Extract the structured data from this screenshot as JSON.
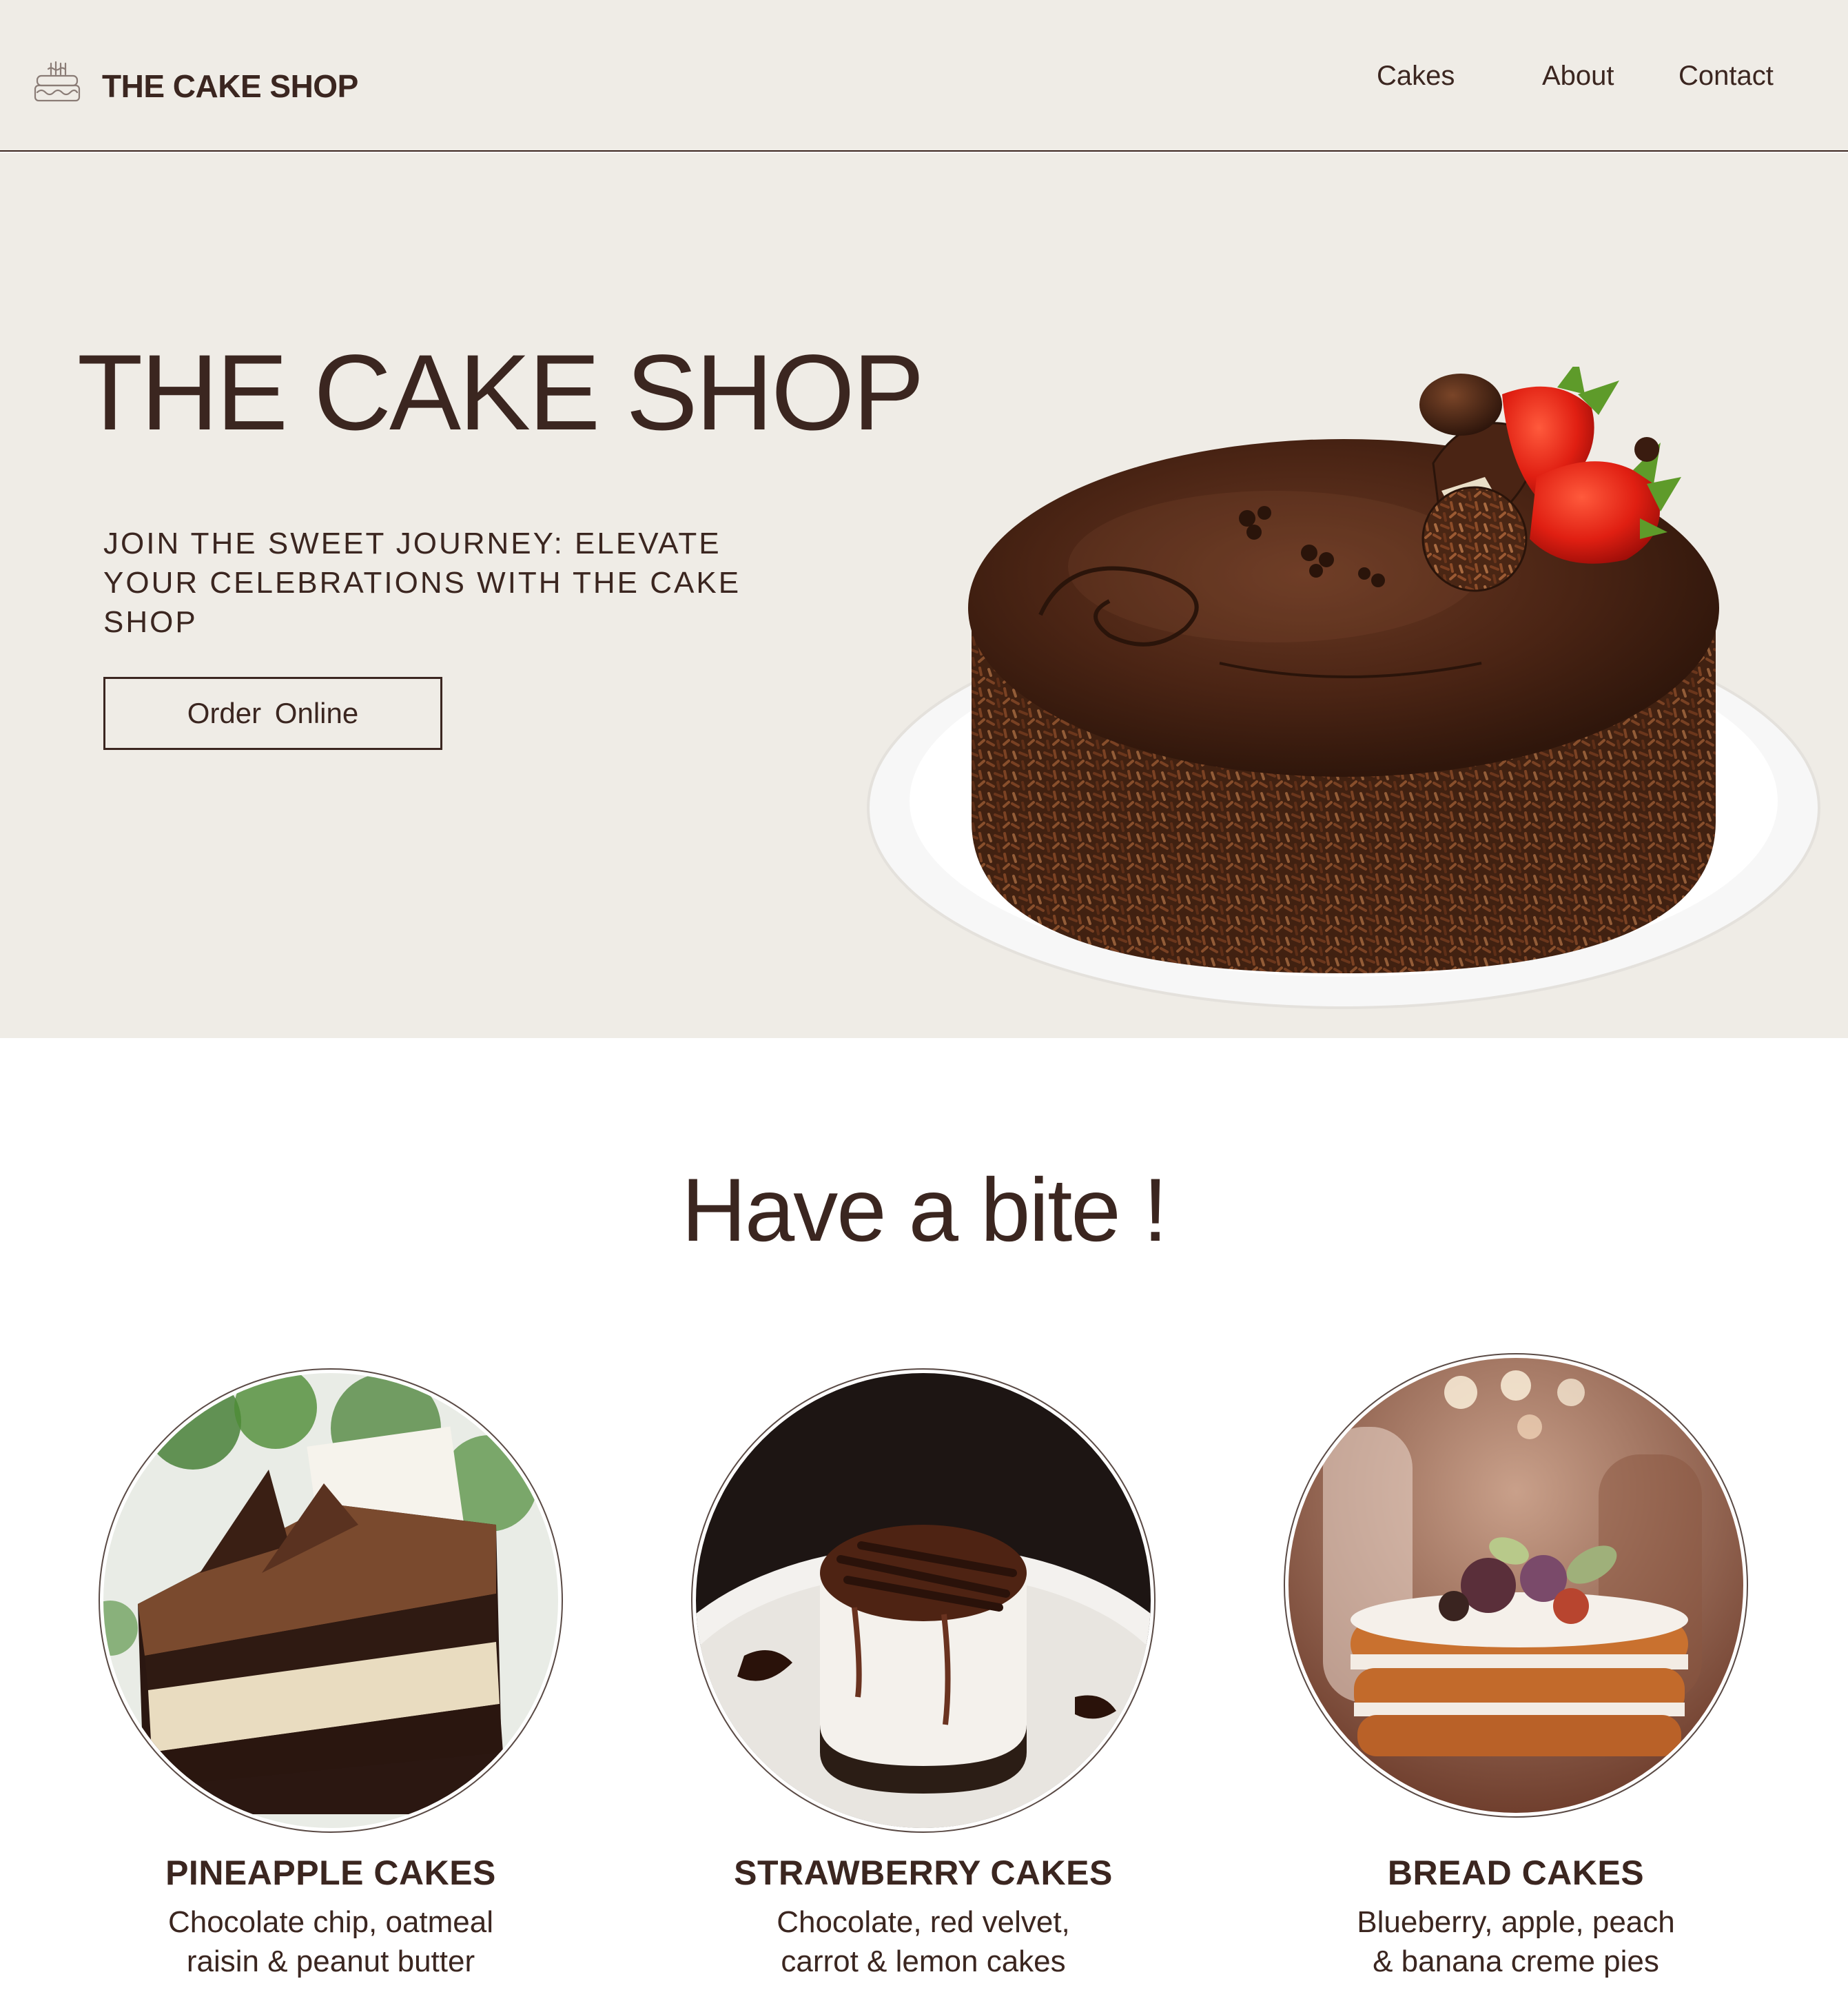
{
  "nav": {
    "brand": "THE CAKE SHOP",
    "links": [
      "Cakes",
      "About",
      "Contact"
    ]
  },
  "hero": {
    "title": "THE CAKE SHOP",
    "tagline": "JOIN THE SWEET JOURNEY: ELEVATE YOUR CELEBRATIONS WITH THE CAKE SHOP",
    "cta": "Order  Online"
  },
  "products": {
    "title": "Have a bite !",
    "items": [
      {
        "name": "PINEAPPLE CAKES",
        "desc": "Chocolate chip, oatmeal raisin & peanut butter"
      },
      {
        "name": "STRAWBERRY CAKES",
        "desc": "Chocolate, red velvet, carrot & lemon cakes"
      },
      {
        "name": "BREAD CAKES",
        "desc": "Blueberry, apple, peach & banana creme pies"
      }
    ]
  },
  "colors": {
    "text": "#3b2620",
    "cream_background": "#efece6",
    "page_background": "#ffffff"
  },
  "icons": [
    "birthday-cake-icon"
  ]
}
